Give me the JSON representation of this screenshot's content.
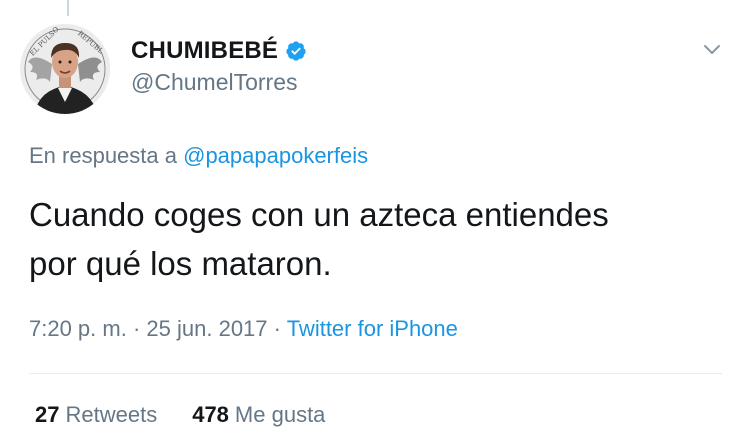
{
  "tweet": {
    "author": {
      "display_name": "CHUMIBEBÉ",
      "handle": "@ChumelTorres",
      "verified": true,
      "avatar_badge_text_left": "EL PULSO",
      "avatar_badge_text_right": "REPUBL"
    },
    "reply": {
      "prefix": "En respuesta a",
      "target": "@papapapokerfeis"
    },
    "text_line_1": "Cuando coges con un azteca entiendes",
    "text_line_2": "por qué los mataron.",
    "meta": {
      "time": "7:20 p. m.",
      "separator_1": "·",
      "date": "25 jun. 2017",
      "separator_2": "·",
      "source": "Twitter for iPhone"
    },
    "stats": {
      "retweets_count": "27",
      "retweets_label": "Retweets",
      "likes_count": "478",
      "likes_label": "Me gusta"
    }
  },
  "colors": {
    "accent": "#1b95e0",
    "muted": "#657786",
    "text": "#14171a",
    "divider": "#e6ecf0"
  },
  "icons": {
    "verified": "verified-badge-icon",
    "menu": "chevron-down-icon"
  }
}
